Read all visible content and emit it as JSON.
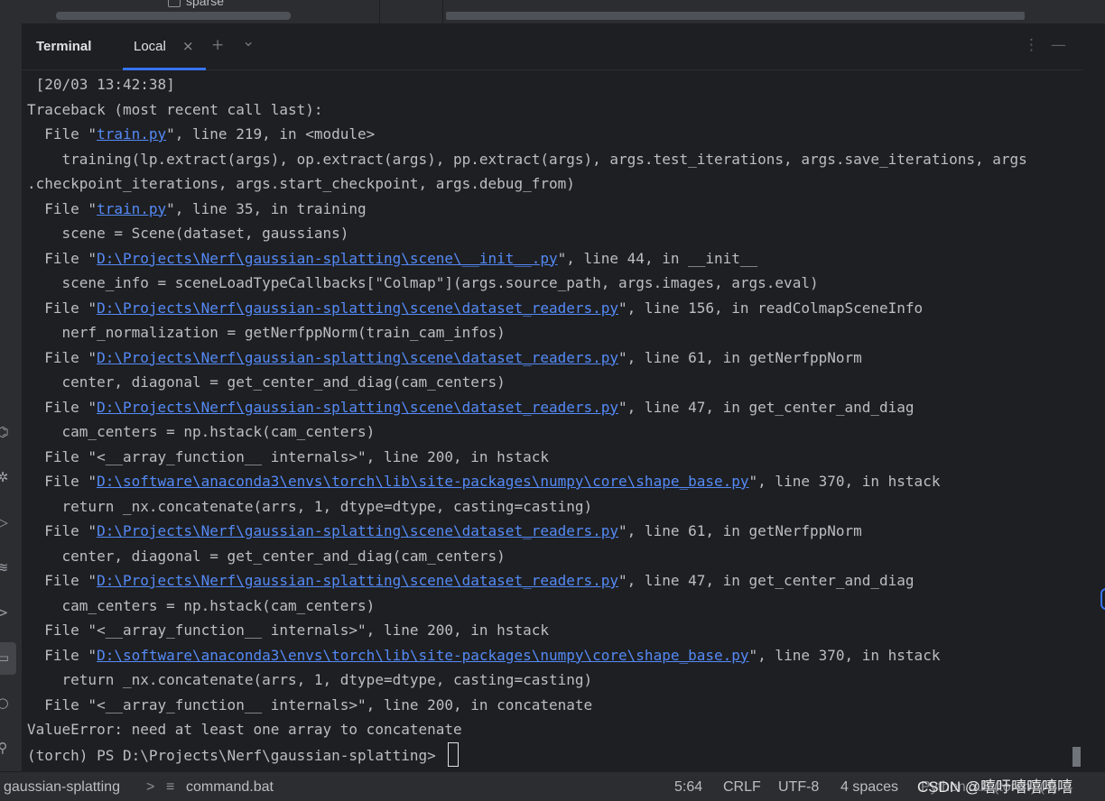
{
  "top_strip": {
    "tree_label": "sparse"
  },
  "terminal": {
    "title": "Terminal",
    "tab_label": "Local",
    "close_glyph": "×",
    "new_tab_glyph": "+",
    "dropdown_glyph": "⌄",
    "more_glyph": "⋮",
    "minimize_glyph": "—",
    "lines": [
      [
        {
          "t": " [20/03 13:42:38]"
        }
      ],
      [
        {
          "t": "Traceback (most recent call last):"
        }
      ],
      [
        {
          "t": "  File \""
        },
        {
          "t": "train.py",
          "link": true
        },
        {
          "t": "\", line 219, in <module>"
        }
      ],
      [
        {
          "t": "    training(lp.extract(args), op.extract(args), pp.extract(args), args.test_iterations, args.save_iterations, args"
        }
      ],
      [
        {
          "t": ".checkpoint_iterations, args.start_checkpoint, args.debug_from)"
        }
      ],
      [
        {
          "t": "  File \""
        },
        {
          "t": "train.py",
          "link": true
        },
        {
          "t": "\", line 35, in training"
        }
      ],
      [
        {
          "t": "    scene = Scene(dataset, gaussians)"
        }
      ],
      [
        {
          "t": "  File \""
        },
        {
          "t": "D:\\Projects\\Nerf\\gaussian-splatting\\scene\\__init__.py",
          "link": true
        },
        {
          "t": "\", line 44, in __init__"
        }
      ],
      [
        {
          "t": "    scene_info = sceneLoadTypeCallbacks[\"Colmap\"](args.source_path, args.images, args.eval)"
        }
      ],
      [
        {
          "t": "  File \""
        },
        {
          "t": "D:\\Projects\\Nerf\\gaussian-splatting\\scene\\dataset_readers.py",
          "link": true
        },
        {
          "t": "\", line 156, in readColmapSceneInfo"
        }
      ],
      [
        {
          "t": "    nerf_normalization = getNerfppNorm(train_cam_infos)"
        }
      ],
      [
        {
          "t": "  File \""
        },
        {
          "t": "D:\\Projects\\Nerf\\gaussian-splatting\\scene\\dataset_readers.py",
          "link": true
        },
        {
          "t": "\", line 61, in getNerfppNorm"
        }
      ],
      [
        {
          "t": "    center, diagonal = get_center_and_diag(cam_centers)"
        }
      ],
      [
        {
          "t": "  File \""
        },
        {
          "t": "D:\\Projects\\Nerf\\gaussian-splatting\\scene\\dataset_readers.py",
          "link": true
        },
        {
          "t": "\", line 47, in get_center_and_diag"
        }
      ],
      [
        {
          "t": "    cam_centers = np.hstack(cam_centers)"
        }
      ],
      [
        {
          "t": "  File \"<__array_function__ internals>\", line 200, in hstack"
        }
      ],
      [
        {
          "t": "  File \""
        },
        {
          "t": "D:\\software\\anaconda3\\envs\\torch\\lib\\site-packages\\numpy\\core\\shape_base.py",
          "link": true
        },
        {
          "t": "\", line 370, in hstack"
        }
      ],
      [
        {
          "t": "    return _nx.concatenate(arrs, 1, dtype=dtype, casting=casting)"
        }
      ],
      [
        {
          "t": "  File \""
        },
        {
          "t": "D:\\Projects\\Nerf\\gaussian-splatting\\scene\\dataset_readers.py",
          "link": true
        },
        {
          "t": "\", line 61, in getNerfppNorm"
        }
      ],
      [
        {
          "t": "    center, diagonal = get_center_and_diag(cam_centers)"
        }
      ],
      [
        {
          "t": "  File \""
        },
        {
          "t": "D:\\Projects\\Nerf\\gaussian-splatting\\scene\\dataset_readers.py",
          "link": true
        },
        {
          "t": "\", line 47, in get_center_and_diag"
        }
      ],
      [
        {
          "t": "    cam_centers = np.hstack(cam_centers)"
        }
      ],
      [
        {
          "t": "  File \"<__array_function__ internals>\", line 200, in hstack"
        }
      ],
      [
        {
          "t": "  File \""
        },
        {
          "t": "D:\\software\\anaconda3\\envs\\torch\\lib\\site-packages\\numpy\\core\\shape_base.py",
          "link": true
        },
        {
          "t": "\", line 370, in hstack"
        }
      ],
      [
        {
          "t": "    return _nx.concatenate(arrs, 1, dtype=dtype, casting=casting)"
        }
      ],
      [
        {
          "t": "  File \"<__array_function__ internals>\", line 200, in concatenate"
        }
      ],
      [
        {
          "t": "ValueError: need at least one array to concatenate"
        }
      ]
    ],
    "prompt": "(torch) PS D:\\Projects\\Nerf\\gaussian-splatting> "
  },
  "left_strip_icons": [
    "python-packages-icon",
    "debug-icon",
    "run-icon",
    "layers-icon",
    "services-icon",
    "terminal-icon",
    "problems-icon",
    "git-icon"
  ],
  "status_bar": {
    "project": "gaussian-splatting",
    "separator": ">",
    "file": "command.bat",
    "position": "5:64",
    "line_ending": "CRLF",
    "encoding": "UTF-8",
    "indent": "4 spaces",
    "interpreter": "Python 3.8 (torch) (4)"
  },
  "watermark": "CSDN @嘻吁嘻嘻嘻嘻"
}
